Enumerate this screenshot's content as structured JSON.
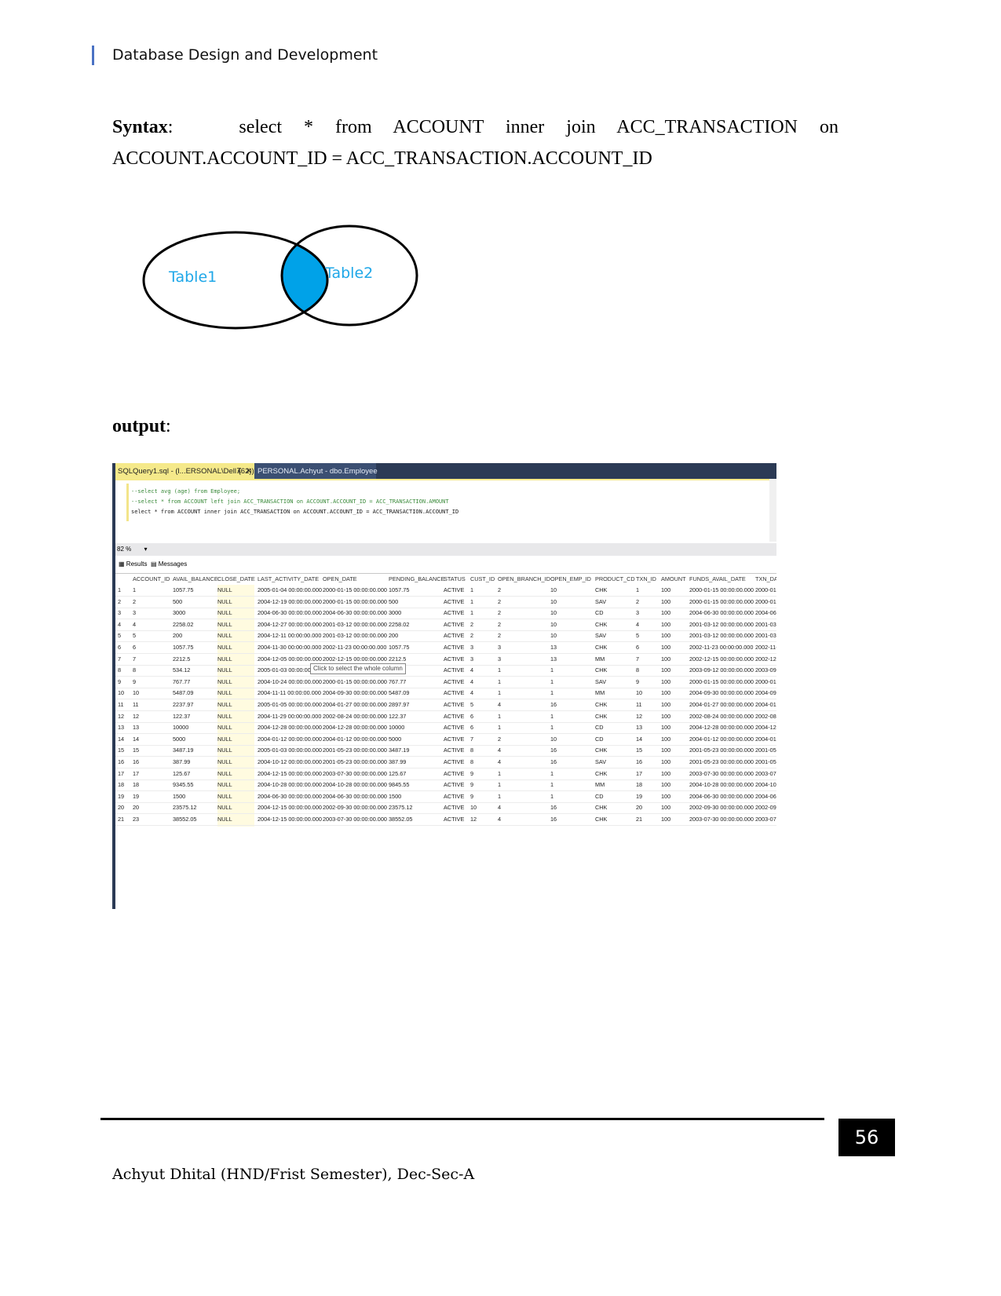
{
  "header": {
    "title": "Database Design and Development"
  },
  "syntax": {
    "label": "Syntax",
    "query": "select * from ACCOUNT inner join ACC_TRANSACTION on ACCOUNT.ACCOUNT_ID = ACC_TRANSACTION.ACCOUNT_ID"
  },
  "venn": {
    "left_label": "Table1",
    "right_label": "Table2",
    "fill_color": "#00a2e8",
    "label_color": "#1ea7e8"
  },
  "output_label": "output",
  "screenshot": {
    "tabs": [
      {
        "label": "SQLQuery1.sql - (l...ERSONAL\\Dell (62))*",
        "pin": "⊼",
        "close": "✕"
      },
      {
        "label": "PERSONAL.Achyut - dbo.Employee"
      }
    ],
    "code": [
      "--select avg (age) from Employee;",
      "--select * from ACCOUNT left join ACC_TRANSACTION on ACCOUNT.ACCOUNT_ID = ACC_TRANSACTION.AMOUNT",
      "select * from ACCOUNT inner join ACC_TRANSACTION on ACCOUNT.ACCOUNT_ID = ACC_TRANSACTION.ACCOUNT_ID"
    ],
    "zoom": "82 %",
    "result_tabs": [
      "Results",
      "Messages"
    ],
    "tooltip": "Click to select the whole column",
    "columns": [
      "",
      "ACCOUNT_ID",
      "AVAIL_BALANCE",
      "CLOSE_DATE",
      "LAST_ACTIVITY_DATE",
      "OPEN_DATE",
      "PENDING_BALANCE",
      "STATUS",
      "CUST_ID",
      "OPEN_BRANCH_ID",
      "OPEN_EMP_ID",
      "PRODUCT_CD",
      "TXN_ID",
      "AMOUNT",
      "FUNDS_AVAIL_DATE",
      "TXN_DAT"
    ],
    "rows": [
      [
        "1",
        "1",
        "1057.75",
        "NULL",
        "2005-01-04 00:00:00.000",
        "2000-01-15 00:00:00.000",
        "1057.75",
        "ACTIVE",
        "1",
        "2",
        "10",
        "CHK",
        "1",
        "100",
        "2000-01-15 00:00:00.000",
        "2000-01-"
      ],
      [
        "2",
        "2",
        "500",
        "NULL",
        "2004-12-19 00:00:00.000",
        "2000-01-15 00:00:00.000",
        "500",
        "ACTIVE",
        "1",
        "2",
        "10",
        "SAV",
        "2",
        "100",
        "2000-01-15 00:00:00.000",
        "2000-01-"
      ],
      [
        "3",
        "3",
        "3000",
        "NULL",
        "2004-06-30 00:00:00.000",
        "2004-06-30 00:00:00.000",
        "3000",
        "ACTIVE",
        "1",
        "2",
        "10",
        "CD",
        "3",
        "100",
        "2004-06-30 00:00:00.000",
        "2004-06-"
      ],
      [
        "4",
        "4",
        "2258.02",
        "NULL",
        "2004-12-27 00:00:00.000",
        "2001-03-12 00:00:00.000",
        "2258.02",
        "ACTIVE",
        "2",
        "2",
        "10",
        "CHK",
        "4",
        "100",
        "2001-03-12 00:00:00.000",
        "2001-03-"
      ],
      [
        "5",
        "5",
        "200",
        "NULL",
        "2004-12-11 00:00:00.000",
        "2001-03-12 00:00:00.000",
        "200",
        "ACTIVE",
        "2",
        "2",
        "10",
        "SAV",
        "5",
        "100",
        "2001-03-12 00:00:00.000",
        "2001-03-"
      ],
      [
        "6",
        "6",
        "1057.75",
        "NULL",
        "2004-11-30 00:00:00.000",
        "2002-11-23 00:00:00.000",
        "1057.75",
        "ACTIVE",
        "3",
        "3",
        "13",
        "CHK",
        "6",
        "100",
        "2002-11-23 00:00:00.000",
        "2002-11-"
      ],
      [
        "7",
        "7",
        "2212.5",
        "NULL",
        "2004-12-05 00:00:00.000",
        "2002-12-15 00:00:00.000",
        "2212.5",
        "ACTIVE",
        "3",
        "3",
        "13",
        "MM",
        "7",
        "100",
        "2002-12-15 00:00:00.000",
        "2002-12-"
      ],
      [
        "8",
        "8",
        "534.12",
        "NULL",
        "2005-01-03 00:00:00.000",
        "",
        "2",
        "ACTIVE",
        "4",
        "1",
        "1",
        "CHK",
        "8",
        "100",
        "2003-09-12 00:00:00.000",
        "2003-09-"
      ],
      [
        "9",
        "9",
        "767.77",
        "NULL",
        "2004-10-24 00:00:00.000",
        "2000-01-15 00:00:00.000",
        "767.77",
        "ACTIVE",
        "4",
        "1",
        "1",
        "SAV",
        "9",
        "100",
        "2000-01-15 00:00:00.000",
        "2000-01-"
      ],
      [
        "10",
        "10",
        "5487.09",
        "NULL",
        "2004-11-11 00:00:00.000",
        "2004-09-30 00:00:00.000",
        "5487.09",
        "ACTIVE",
        "4",
        "1",
        "1",
        "MM",
        "10",
        "100",
        "2004-09-30 00:00:00.000",
        "2004-09-"
      ],
      [
        "11",
        "11",
        "2237.97",
        "NULL",
        "2005-01-05 00:00:00.000",
        "2004-01-27 00:00:00.000",
        "2897.97",
        "ACTIVE",
        "5",
        "4",
        "16",
        "CHK",
        "11",
        "100",
        "2004-01-27 00:00:00.000",
        "2004-01-"
      ],
      [
        "12",
        "12",
        "122.37",
        "NULL",
        "2004-11-29 00:00:00.000",
        "2002-08-24 00:00:00.000",
        "122.37",
        "ACTIVE",
        "6",
        "1",
        "1",
        "CHK",
        "12",
        "100",
        "2002-08-24 00:00:00.000",
        "2002-08-"
      ],
      [
        "13",
        "13",
        "10000",
        "NULL",
        "2004-12-28 00:00:00.000",
        "2004-12-28 00:00:00.000",
        "10000",
        "ACTIVE",
        "6",
        "1",
        "1",
        "CD",
        "13",
        "100",
        "2004-12-28 00:00:00.000",
        "2004-12-"
      ],
      [
        "14",
        "14",
        "5000",
        "NULL",
        "2004-01-12 00:00:00.000",
        "2004-01-12 00:00:00.000",
        "5000",
        "ACTIVE",
        "7",
        "2",
        "10",
        "CD",
        "14",
        "100",
        "2004-01-12 00:00:00.000",
        "2004-01-"
      ],
      [
        "15",
        "15",
        "3487.19",
        "NULL",
        "2005-01-03 00:00:00.000",
        "2001-05-23 00:00:00.000",
        "3487.19",
        "ACTIVE",
        "8",
        "4",
        "16",
        "CHK",
        "15",
        "100",
        "2001-05-23 00:00:00.000",
        "2001-05-"
      ],
      [
        "16",
        "16",
        "387.99",
        "NULL",
        "2004-10-12 00:00:00.000",
        "2001-05-23 00:00:00.000",
        "387.99",
        "ACTIVE",
        "8",
        "4",
        "16",
        "SAV",
        "16",
        "100",
        "2001-05-23 00:00:00.000",
        "2001-05-"
      ],
      [
        "17",
        "17",
        "125.67",
        "NULL",
        "2004-12-15 00:00:00.000",
        "2003-07-30 00:00:00.000",
        "125.67",
        "ACTIVE",
        "9",
        "1",
        "1",
        "CHK",
        "17",
        "100",
        "2003-07-30 00:00:00.000",
        "2003-07-"
      ],
      [
        "18",
        "18",
        "9345.55",
        "NULL",
        "2004-10-28 00:00:00.000",
        "2004-10-28 00:00:00.000",
        "9845.55",
        "ACTIVE",
        "9",
        "1",
        "1",
        "MM",
        "18",
        "100",
        "2004-10-28 00:00:00.000",
        "2004-10-"
      ],
      [
        "19",
        "19",
        "1500",
        "NULL",
        "2004-06-30 00:00:00.000",
        "2004-06-30 00:00:00.000",
        "1500",
        "ACTIVE",
        "9",
        "1",
        "1",
        "CD",
        "19",
        "100",
        "2004-06-30 00:00:00.000",
        "2004-06-"
      ],
      [
        "20",
        "20",
        "23575.12",
        "NULL",
        "2004-12-15 00:00:00.000",
        "2002-09-30 00:00:00.000",
        "23575.12",
        "ACTIVE",
        "10",
        "4",
        "16",
        "CHK",
        "20",
        "100",
        "2002-09-30 00:00:00.000",
        "2002-09-"
      ],
      [
        "21",
        "23",
        "38552.05",
        "NULL",
        "2004-12-15 00:00:00.000",
        "2003-07-30 00:00:00.000",
        "38552.05",
        "ACTIVE",
        "12",
        "4",
        "16",
        "CHK",
        "21",
        "100",
        "2003-07-30 00:00:00.000",
        "2003-07-"
      ]
    ]
  },
  "footer": {
    "page_number": "56",
    "author": "Achyut Dhital (HND/Frist Semester), Dec-Sec-A"
  }
}
